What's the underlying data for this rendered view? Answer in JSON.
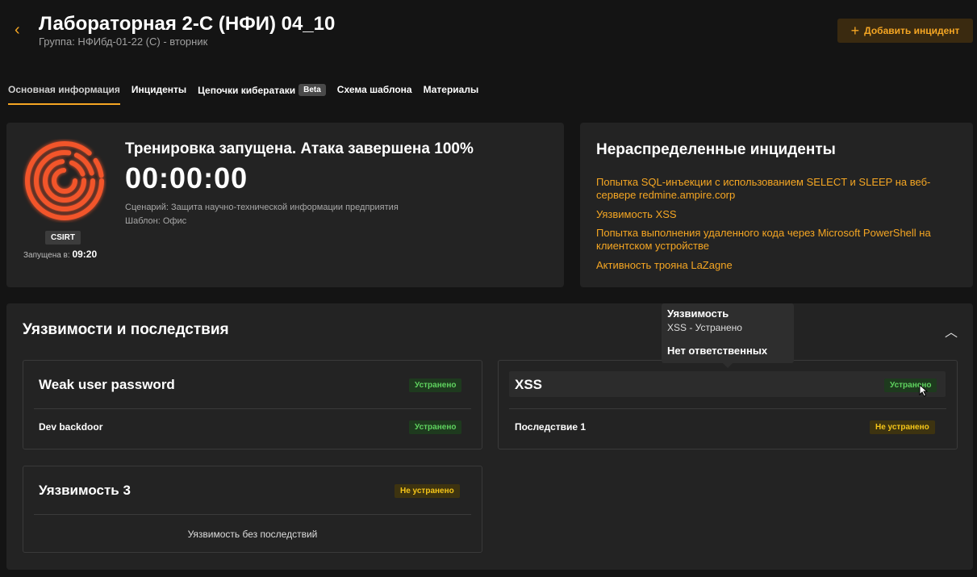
{
  "header": {
    "back_icon": "chevron-left-icon",
    "title": "Лабораторная 2-С (НФИ) 04_10",
    "subtitle": "Группа: НФИбд-01-22 (С) - вторник",
    "add_button": "Добавить инцидент",
    "accent": "#f5a623"
  },
  "tabs": [
    {
      "label": "Основная информация",
      "active": true
    },
    {
      "label": "Инциденты"
    },
    {
      "label": "Цепочки кибератаки",
      "badge": "Beta"
    },
    {
      "label": "Схема шаблона"
    },
    {
      "label": "Материалы"
    }
  ],
  "training": {
    "status": "Тренировка запущена. Атака завершена 100%",
    "timer": "00:00:00",
    "scenario": "Сценарий: Защита научно-технической информации предприятия",
    "template": "Шаблон: Офис",
    "role": "CSIRT",
    "started_label": "Запущена в:",
    "started_time": "09:20"
  },
  "incidents": {
    "title": "Нераспределенные инциденты",
    "items": [
      "Попытка SQL-инъекции с использованием SELECT и SLEEP на веб-сервере redmine.ampire.corp",
      "Уязвимость XSS",
      "Попытка выполнения удаленного кода через Microsoft PowerShell на клиентском устройстве",
      "Активность трояна LaZagne"
    ]
  },
  "vulnerabilities": {
    "title": "Уязвимости и последствия",
    "collapse_icon": "chevron-up-icon",
    "items": [
      {
        "name": "Weak user password",
        "status": "Устранено",
        "consequence": "Dev backdoor",
        "consequence_status": "Устранено"
      },
      {
        "name": "XSS",
        "status": "Устранено",
        "consequence": "Последствие 1",
        "consequence_status": "Не устранено"
      },
      {
        "name": "Уязвимость 3",
        "status": "Не устранено",
        "no_consequences": "Уязвимость без последствий"
      }
    ],
    "status_colors": {
      "fixed": "#5fd35f",
      "not_fixed": "#f5c518"
    }
  },
  "tooltip": {
    "title": "Уязвимость",
    "line": "XSS - Устранено",
    "owner": "Нет ответственных"
  }
}
